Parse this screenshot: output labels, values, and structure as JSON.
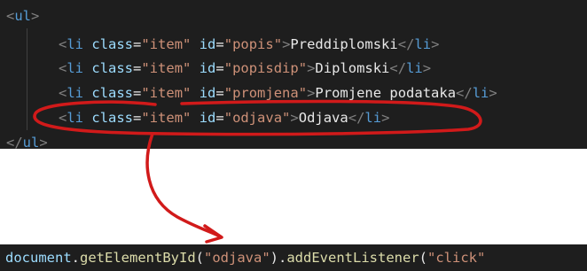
{
  "code_block": {
    "lines": [
      {
        "open": "<",
        "tag": "ul",
        "close": ">"
      },
      {
        "open": "<",
        "tag": "li",
        "attr1": "class",
        "eq1": "=",
        "val1": "\"item\"",
        "attr2": "id",
        "eq2": "=",
        "val2": "\"popis\"",
        "gt": ">",
        "text": "Preddiplomski",
        "endopen": "</",
        "endtag": "li",
        "endclose": ">"
      },
      {
        "open": "<",
        "tag": "li",
        "attr1": "class",
        "eq1": "=",
        "val1": "\"item\"",
        "attr2": "id",
        "eq2": "=",
        "val2": "\"popisdip\"",
        "gt": ">",
        "text": "Diplomski",
        "endopen": "</",
        "endtag": "li",
        "endclose": ">"
      },
      {
        "open": "<",
        "tag": "li",
        "attr1": "class",
        "eq1": "=",
        "val1": "\"item\"",
        "attr2": "id",
        "eq2": "=",
        "val2": "\"promjena\"",
        "gt": ">",
        "text": "Promjene podataka",
        "endopen": "</",
        "endtag": "li",
        "endclose": ">"
      },
      {
        "open": "<",
        "tag": "li",
        "attr1": "class",
        "eq1": "=",
        "val1": "\"item\"",
        "attr2": "id",
        "eq2": "=",
        "val2": "\"odjava\"",
        "gt": ">",
        "text": "Odjava",
        "endopen": "</",
        "endtag": "li",
        "endclose": ">"
      },
      {
        "open": "</",
        "tag": "ul",
        "close": ">"
      }
    ]
  },
  "js_line": {
    "object": "document",
    "dot1": ".",
    "method1": "getElementById",
    "paren1": "(",
    "arg1": "\"odjava\"",
    "paren2": ")",
    "dot2": ".",
    "method2": "addEventListener",
    "paren3": "(",
    "arg2": "\"click\""
  },
  "colors": {
    "background": "#1e1e1e",
    "tag": "#569cd6",
    "attribute": "#9cdcfe",
    "string": "#ce9178",
    "function": "#dcdcaa",
    "annotation": "#d11a1a"
  }
}
